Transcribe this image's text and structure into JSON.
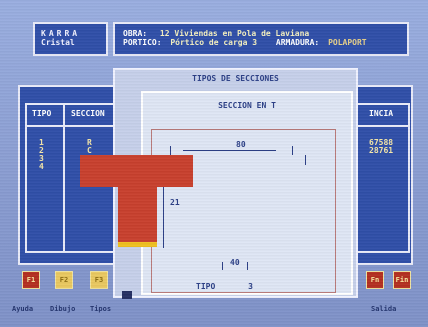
{
  "app": {
    "name_line1": "KARRA",
    "name_line2": "Cristal"
  },
  "header": {
    "obra_label": "OBRA:",
    "obra_value": "12 Viviendas en Pola de Laviana",
    "portico_label": "PORTICO:",
    "portico_value": "Pórtico de carga 3",
    "armadura_label": "ARMADURA:",
    "armadura_value": "POLAPORT"
  },
  "table": {
    "headers": [
      "TIPO",
      "SECCION"
    ],
    "tipos": [
      "1",
      "2",
      "3",
      "4"
    ],
    "secciones": [
      "R",
      "C"
    ],
    "right_header": "INCIA",
    "right_values": [
      "67588",
      "28761"
    ]
  },
  "dialog": {
    "title": "TIPOS DE SECCIONES",
    "subtitle": "SECCION EN T",
    "dim_top": "80",
    "dim_left": "21",
    "dim_bottom": "40",
    "type_label": "TIPO",
    "type_value": "3"
  },
  "function_keys": {
    "f1": "F1",
    "f2": "F2",
    "f3": "F3",
    "f9": "Fn",
    "f10": "Fin",
    "labels": {
      "ayuda": "Ayuda",
      "dibujo": "Dibujo",
      "tipos": "Tipos",
      "salida": "Salida"
    }
  },
  "colors": {
    "accent": "#2f4fa8",
    "section": "#c8402d",
    "base": "#f0c020"
  }
}
